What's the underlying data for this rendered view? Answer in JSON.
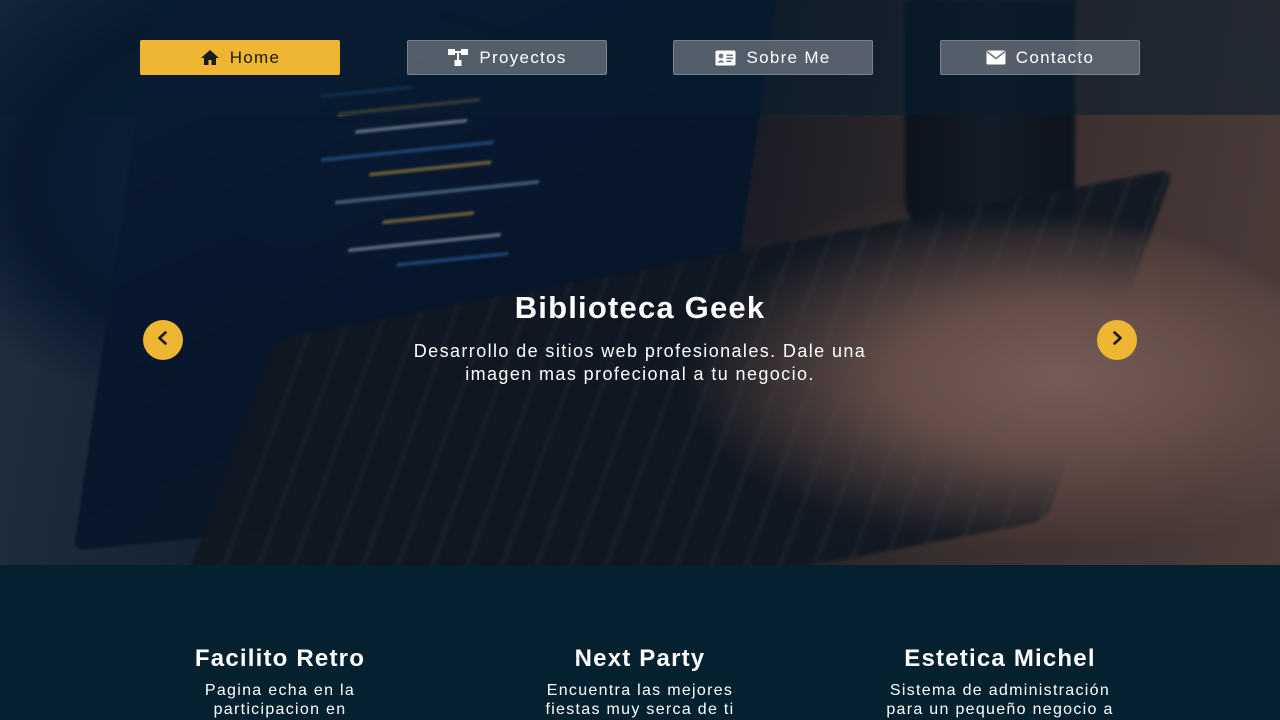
{
  "nav": {
    "items": [
      {
        "label": "Home",
        "icon": "home-icon",
        "active": true
      },
      {
        "label": "Proyectos",
        "icon": "sitemap-icon",
        "active": false
      },
      {
        "label": "Sobre Me",
        "icon": "id-card-icon",
        "active": false
      },
      {
        "label": "Contacto",
        "icon": "envelope-icon",
        "active": false
      }
    ]
  },
  "carousel": {
    "title": "Biblioteca Geek",
    "text": "Desarrollo de sitios web profesionales. Dale una imagen mas profecional a tu negocio.",
    "prev_icon": "chevron-left-icon",
    "next_icon": "chevron-right-icon"
  },
  "projects": [
    {
      "title": "Facilito Retro",
      "text": "Pagina echa en la participacion en"
    },
    {
      "title": "Next Party",
      "text": "Encuentra las mejores fiestas muy serca de ti"
    },
    {
      "title": "Estetica Michel",
      "text": "Sistema de administración para un pequeño negocio a"
    }
  ],
  "colors": {
    "accent": "#efb633",
    "background": "#05202f",
    "nav_button": "#6e7680"
  }
}
